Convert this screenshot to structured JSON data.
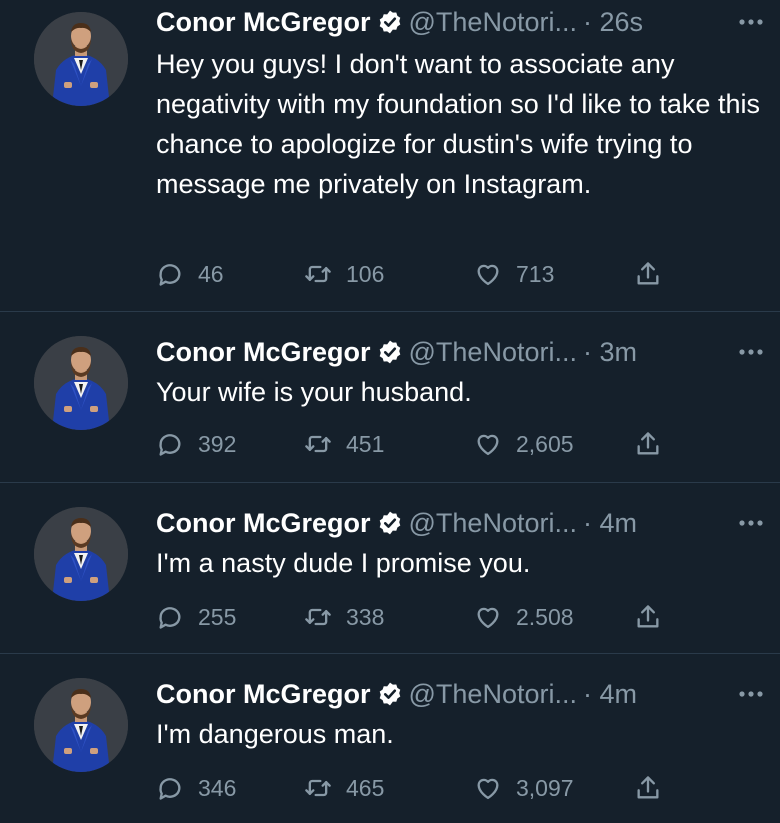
{
  "tweets": [
    {
      "name": "Conor McGregor",
      "handle": "@TheNotori...",
      "time": "· 26s",
      "text": "Hey you guys! I don't want to associate any negativity with my foundation so I'd like to take this chance to apologize for dustin's wife trying to message me privately on Instagram.",
      "replies": "46",
      "retweets": "106",
      "likes": "713"
    },
    {
      "name": "Conor McGregor",
      "handle": "@TheNotori...",
      "time": "· 3m",
      "text": "Your wife is your husband.",
      "replies": "392",
      "retweets": "451",
      "likes": "2,605"
    },
    {
      "name": "Conor McGregor",
      "handle": "@TheNotori...",
      "time": "· 4m",
      "text": "I'm a nasty dude I promise you.",
      "replies": "255",
      "retweets": "338",
      "likes": "2.508"
    },
    {
      "name": "Conor McGregor",
      "handle": "@TheNotori...",
      "time": "· 4m",
      "text": "I'm dangerous man.",
      "replies": "346",
      "retweets": "465",
      "likes": "3,097"
    }
  ],
  "icons": {
    "verified": "verified-badge-icon",
    "more": "more-dots-icon",
    "reply": "reply-bubble-icon",
    "retweet": "retweet-arrows-icon",
    "like": "heart-icon",
    "share": "share-upload-icon"
  },
  "colors": {
    "background": "#15202b",
    "text": "#ffffff",
    "muted": "#8899a6",
    "divider": "#2a3a4a",
    "suit_blue": "#1f3fa8"
  }
}
